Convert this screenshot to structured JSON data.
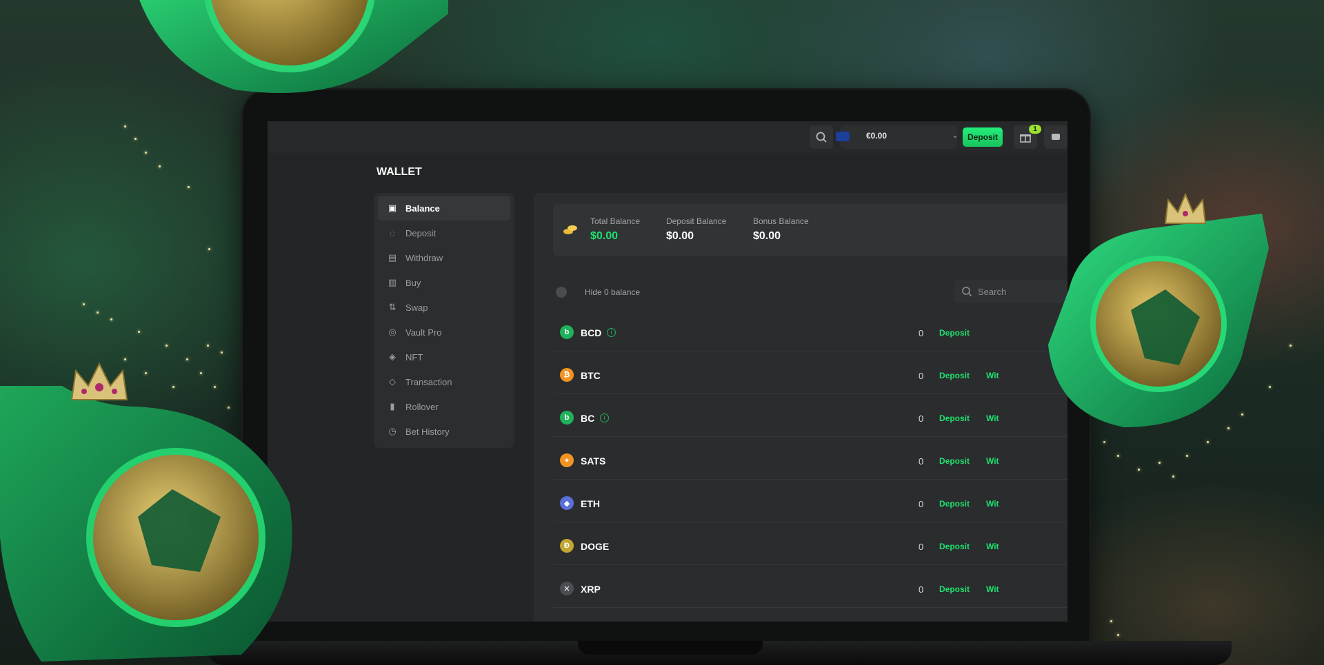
{
  "header": {
    "currency_amount": "€0.00",
    "deposit_label": "Deposit",
    "gift_badge": "1"
  },
  "wallet": {
    "title": "WALLET",
    "nav": [
      {
        "label": "Balance",
        "icon": "wallet-icon",
        "active": true
      },
      {
        "label": "Deposit",
        "icon": "deposit-icon"
      },
      {
        "label": "Withdraw",
        "icon": "withdraw-icon"
      },
      {
        "label": "Buy",
        "icon": "buy-icon"
      },
      {
        "label": "Swap",
        "icon": "swap-icon"
      },
      {
        "label": "Vault Pro",
        "icon": "vault-icon"
      },
      {
        "label": "NFT",
        "icon": "nft-icon"
      },
      {
        "label": "Transaction",
        "icon": "transaction-icon"
      },
      {
        "label": "Rollover",
        "icon": "rollover-icon"
      },
      {
        "label": "Bet History",
        "icon": "history-icon"
      }
    ],
    "balances": {
      "total_label": "Total Balance",
      "total_value": "$0.00",
      "deposit_label": "Deposit Balance",
      "deposit_value": "$0.00",
      "bonus_label": "Bonus Balance",
      "bonus_value": "$0.00"
    },
    "hide_zero_label": "Hide 0 balance",
    "search_placeholder": "Search",
    "coins": [
      {
        "symbol": "BCD",
        "amount": "0",
        "deposit": "Deposit",
        "withdraw": "",
        "color": "#1fb25a",
        "glyph": "b",
        "info": true
      },
      {
        "symbol": "BTC",
        "amount": "0",
        "deposit": "Deposit",
        "withdraw": "Wit",
        "color": "#f39321",
        "glyph": "₿"
      },
      {
        "symbol": "BC",
        "amount": "0",
        "deposit": "Deposit",
        "withdraw": "Wit",
        "color": "#1fb25a",
        "glyph": "b",
        "info": true
      },
      {
        "symbol": "SATS",
        "amount": "0",
        "deposit": "Deposit",
        "withdraw": "Wit",
        "color": "#f39321",
        "glyph": "✦"
      },
      {
        "symbol": "ETH",
        "amount": "0",
        "deposit": "Deposit",
        "withdraw": "Wit",
        "color": "#5b6fd8",
        "glyph": "◆"
      },
      {
        "symbol": "DOGE",
        "amount": "0",
        "deposit": "Deposit",
        "withdraw": "Wit",
        "color": "#c2a633",
        "glyph": "Ð"
      },
      {
        "symbol": "XRP",
        "amount": "0",
        "deposit": "Deposit",
        "withdraw": "Wit",
        "color": "#4b4e52",
        "glyph": "✕"
      }
    ]
  },
  "colors": {
    "accent": "#1fe06e",
    "panel": "#2a2c2e",
    "brand_green": "#19b35c"
  }
}
